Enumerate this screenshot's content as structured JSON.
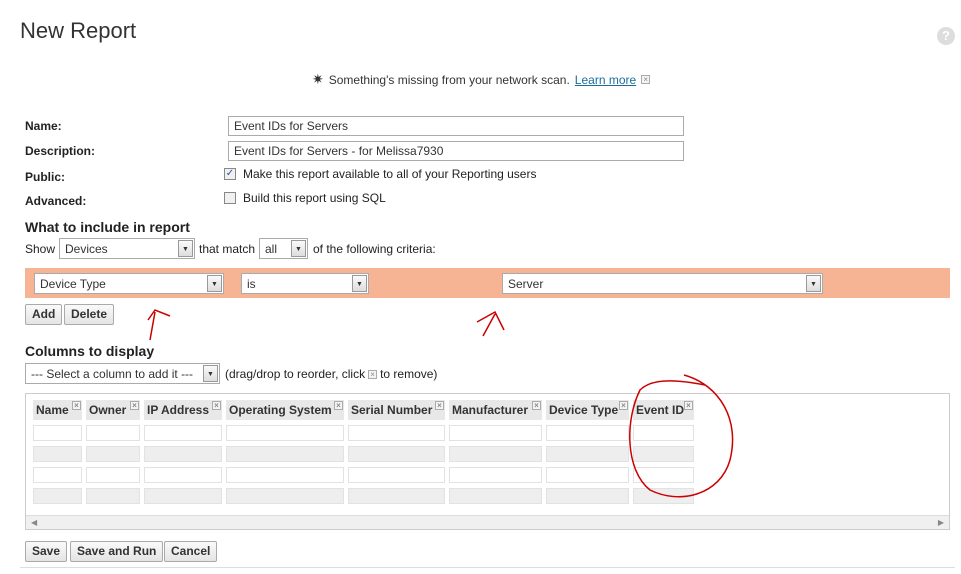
{
  "title": "New Report",
  "help_icon": "?",
  "notice": {
    "text": "Something's missing from your network scan.",
    "link": "Learn more",
    "close": "×"
  },
  "form": {
    "name_label": "Name:",
    "name_value": "Event IDs for Servers",
    "description_label": "Description:",
    "description_value": "Event IDs for Servers - for Melissa7930",
    "public_label": "Public:",
    "public_text": "Make this report available to all of your Reporting users",
    "public_checked": true,
    "advanced_label": "Advanced:",
    "advanced_text": "Build this report using SQL",
    "advanced_checked": false
  },
  "include": {
    "heading": "What to include in report",
    "show_label": "Show",
    "show_value": "Devices",
    "match_label": "that match",
    "match_value": "all",
    "criteria_label": "of the following criteria:",
    "criteria": {
      "field": "Device Type",
      "operator": "is",
      "value": "Server"
    },
    "add_label": "Add",
    "delete_label": "Delete"
  },
  "columns": {
    "heading": "Columns to display",
    "select_value": "--- Select a column to add it ---",
    "hint_before": "(drag/drop to reorder, click",
    "hint_after": "to remove)",
    "headers": [
      "Name",
      "Owner",
      "IP Address",
      "Operating System",
      "Serial Number",
      "Manufacturer",
      "Device Type",
      "Event ID"
    ]
  },
  "footer": {
    "save": "Save",
    "save_run": "Save and Run",
    "cancel": "Cancel"
  }
}
